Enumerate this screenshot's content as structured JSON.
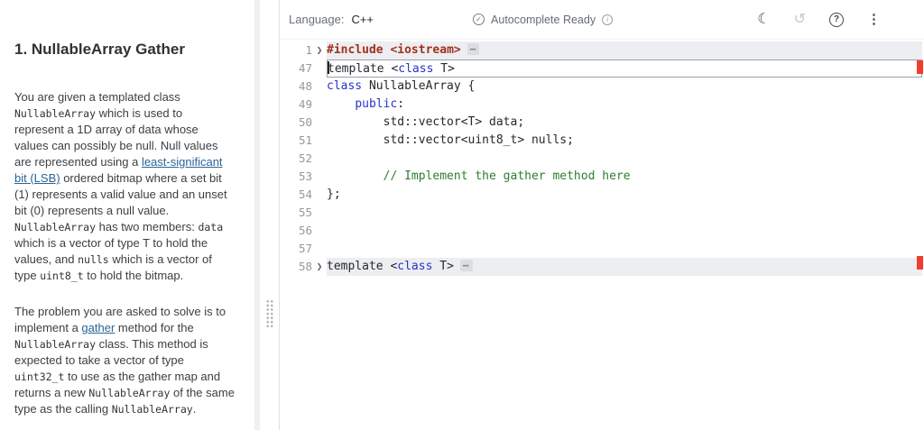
{
  "problem": {
    "title": "1. NullableArray Gather",
    "paragraphs": [
      {
        "segments": [
          {
            "k": "t",
            "s": "You are given a templated class "
          },
          {
            "k": "c",
            "s": "NullableArray"
          },
          {
            "k": "t",
            "s": " which is used to represent a 1D array of data whose values can possibly be null. Null values are represented using a "
          },
          {
            "k": "l",
            "s": "least-significant bit (LSB)"
          },
          {
            "k": "t",
            "s": " ordered bitmap where a set bit (1) represents a valid value and an unset bit (0) represents a null value. "
          },
          {
            "k": "c",
            "s": "NullableArray"
          },
          {
            "k": "t",
            "s": " has two members: "
          },
          {
            "k": "c",
            "s": "data"
          },
          {
            "k": "t",
            "s": " which is a vector of type T to hold the values, and "
          },
          {
            "k": "c",
            "s": "nulls"
          },
          {
            "k": "t",
            "s": " which is a vector of type "
          },
          {
            "k": "c",
            "s": "uint8_t"
          },
          {
            "k": "t",
            "s": " to hold the bitmap."
          }
        ]
      },
      {
        "segments": [
          {
            "k": "t",
            "s": "The problem you are asked to solve is to implement a "
          },
          {
            "k": "l",
            "s": "gather"
          },
          {
            "k": "t",
            "s": " method for the "
          },
          {
            "k": "c",
            "s": "NullableArray"
          },
          {
            "k": "t",
            "s": " class. This method is expected to take a vector of type "
          },
          {
            "k": "c",
            "s": "uint32_t"
          },
          {
            "k": "t",
            "s": " to use as the gather map and returns a new "
          },
          {
            "k": "c",
            "s": "NullableArray"
          },
          {
            "k": "t",
            "s": " of the same type as the calling "
          },
          {
            "k": "c",
            "s": "NullableArray"
          },
          {
            "k": "t",
            "s": "."
          }
        ]
      }
    ]
  },
  "toolbar": {
    "language_label": "Language:",
    "language_value": "C++",
    "autocomplete_status": "Autocomplete Ready"
  },
  "icons": {
    "autocomplete_check": "✓",
    "info": "i",
    "theme_toggle": "☾",
    "history": "↺",
    "help": "?",
    "kebab": "⋮",
    "fold_chevron": "❯",
    "folded_ellipsis": "⋯"
  },
  "editor": {
    "lines": [
      {
        "num": "1",
        "fold": true,
        "highlight": true,
        "ellipsis": true,
        "tokens": [
          {
            "s": "#include ",
            "c": "pp"
          },
          {
            "s": "<iostream>",
            "c": "pp"
          }
        ]
      },
      {
        "num": "47",
        "boxed": true,
        "cursor": true,
        "tokens": [
          {
            "s": "template <",
            "c": "d"
          },
          {
            "s": "class",
            "c": "kw"
          },
          {
            "s": " T>",
            "c": "d"
          }
        ]
      },
      {
        "num": "48",
        "tokens": [
          {
            "s": "class",
            "c": "kw"
          },
          {
            "s": " NullableArray {",
            "c": "d"
          }
        ]
      },
      {
        "num": "49",
        "tokens": [
          {
            "s": "    ",
            "c": "d"
          },
          {
            "s": "public",
            "c": "kw"
          },
          {
            "s": ":",
            "c": "d"
          }
        ]
      },
      {
        "num": "50",
        "tokens": [
          {
            "s": "        std::vector<T> data;",
            "c": "d"
          }
        ]
      },
      {
        "num": "51",
        "tokens": [
          {
            "s": "        std::vector<uint8_t> nulls;",
            "c": "d"
          }
        ]
      },
      {
        "num": "52",
        "tokens": []
      },
      {
        "num": "53",
        "tokens": [
          {
            "s": "        // Implement the gather method here",
            "c": "cm"
          }
        ]
      },
      {
        "num": "54",
        "tokens": [
          {
            "s": "};",
            "c": "d"
          }
        ]
      },
      {
        "num": "55",
        "tokens": []
      },
      {
        "num": "56",
        "tokens": []
      },
      {
        "num": "57",
        "tokens": []
      },
      {
        "num": "58",
        "fold": true,
        "highlight": true,
        "ellipsis": true,
        "tokens": [
          {
            "s": "template <",
            "c": "d"
          },
          {
            "s": "class",
            "c": "kw"
          },
          {
            "s": " T>",
            "c": "d"
          }
        ]
      }
    ]
  },
  "colors": {
    "keyword": "#2433cc",
    "comment": "#2e7d32",
    "preprocessor": "#a3301c",
    "error_marker": "#f03e2d",
    "link": "#2a6496",
    "fold_highlight": "#eceef1"
  }
}
